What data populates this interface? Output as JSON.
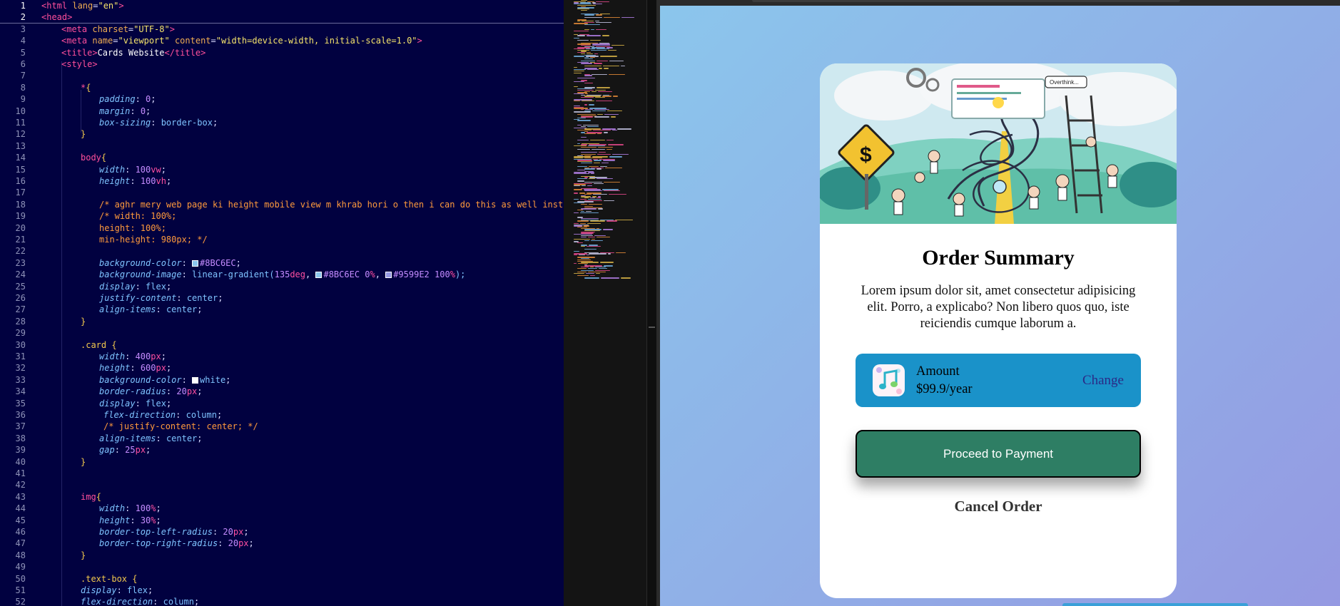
{
  "editor": {
    "line_numbers": [
      "1",
      "2",
      "3",
      "4",
      "5",
      "6",
      "7",
      "8",
      "9",
      "10",
      "11",
      "12",
      "13",
      "14",
      "15",
      "16",
      "17",
      "18",
      "19",
      "20",
      "21",
      "22",
      "23",
      "24",
      "25",
      "26",
      "27",
      "28",
      "29",
      "30",
      "31",
      "32",
      "33",
      "34",
      "35",
      "36",
      "37",
      "38",
      "39",
      "40",
      "41",
      "42",
      "43",
      "44",
      "45",
      "46",
      "47",
      "48",
      "49",
      "50",
      "51",
      "52"
    ],
    "lines": {
      "l1_tag": "<html",
      "l1_attr": " lang",
      "l1_eq": "=",
      "l1_val": "\"en\"",
      "l1_close": ">",
      "l2": "<head>",
      "l3_tag": "<meta",
      "l3_attr": " charset",
      "l3_eq": "=",
      "l3_val": "\"UTF-8\"",
      "l3_close": ">",
      "l4_tag": "<meta",
      "l4_attr1": " name",
      "l4_eq1": "=",
      "l4_val1": "\"viewport\"",
      "l4_attr2": " content",
      "l4_eq2": "=",
      "l4_val2": "\"width=device-width, initial-scale=1.0\"",
      "l4_close": ">",
      "l5_open": "<title>",
      "l5_text": "Cards Website",
      "l5_close": "</title>",
      "l6": "<style>",
      "l8_sel": "*",
      "l8_brace": "{",
      "l9_prop": "padding",
      "l9_sep": ": ",
      "l9_val": "0",
      "l9_end": ";",
      "l10_prop": "margin",
      "l10_sep": ": ",
      "l10_val": "0",
      "l10_end": ";",
      "l11_prop": "box-sizing",
      "l11_sep": ": ",
      "l11_val": "border-box",
      "l11_end": ";",
      "l12": "}",
      "l14_sel": "body",
      "l14_brace": "{",
      "l15_prop": "width",
      "l15_sep": ": ",
      "l15_num": "100",
      "l15_unit": "vw",
      "l15_end": ";",
      "l16_prop": "height",
      "l16_sep": ": ",
      "l16_num": "100",
      "l16_unit": "vh",
      "l16_end": ";",
      "l18": "/* aghr mery web page ki height mobile view m khrab hori o then i can do this as well instead of above",
      "l19": "/* width: 100%;",
      "l20": "height: 100%;",
      "l21": "min-height: 980px; */",
      "l23_prop": "background-color",
      "l23_sep": ": ",
      "l23_val": "#8BC6EC",
      "l23_end": ";",
      "l24_prop": "background-image",
      "l24_sep": ": ",
      "l24_fn": "linear-gradient(",
      "l24_deg": "135",
      "l24_degu": "deg",
      "l24_c1": "#8BC6EC",
      "l24_p1": "0",
      "l24_p1u": "%",
      "l24_c2": "#9599E2",
      "l24_p2": "100",
      "l24_p2u": "%",
      "l24_end": ");",
      "l25_prop": "display",
      "l25_sep": ": ",
      "l25_val": "flex",
      "l25_end": ";",
      "l26_prop": "justify-content",
      "l26_sep": ": ",
      "l26_val": "center",
      "l26_end": ";",
      "l27_prop": "align-items",
      "l27_sep": ": ",
      "l27_val": "center",
      "l27_end": ";",
      "l28": "}",
      "l30_sel": ".card",
      "l30_brace": " {",
      "l31_prop": "width",
      "l31_sep": ": ",
      "l31_num": "400",
      "l31_unit": "px",
      "l31_end": ";",
      "l32_prop": "height",
      "l32_sep": ": ",
      "l32_num": "600",
      "l32_unit": "px",
      "l32_end": ";",
      "l33_prop": "background-color",
      "l33_sep": ": ",
      "l33_val": "white",
      "l33_end": ";",
      "l34_prop": "border-radius",
      "l34_sep": ": ",
      "l34_num": "20",
      "l34_unit": "px",
      "l34_end": ";",
      "l35_prop": "display",
      "l35_sep": ": ",
      "l35_val": "flex",
      "l35_end": ";",
      "l36_prop": "flex-direction",
      "l36_sep": ": ",
      "l36_val": "column",
      "l36_end": ";",
      "l37": "/* justify-content: center; */",
      "l38_prop": "align-items",
      "l38_sep": ": ",
      "l38_val": "center",
      "l38_end": ";",
      "l39_prop": "gap",
      "l39_sep": ": ",
      "l39_num": "25",
      "l39_unit": "px",
      "l39_end": ";",
      "l40": "}",
      "l43_sel": "img",
      "l43_brace": "{",
      "l44_prop": "width",
      "l44_sep": ": ",
      "l44_num": "100",
      "l44_unit": "%",
      "l44_end": ";",
      "l45_prop": "height",
      "l45_sep": ": ",
      "l45_num": "30",
      "l45_unit": "%",
      "l45_end": ";",
      "l46_prop": "border-top-left-radius",
      "l46_sep": ": ",
      "l46_num": "20",
      "l46_unit": "px",
      "l46_end": ";",
      "l47_prop": "border-top-right-radius",
      "l47_sep": ": ",
      "l47_num": "20",
      "l47_unit": "px",
      "l47_end": ";",
      "l48": "}",
      "l50_sel": ".text-box",
      "l50_brace": " {",
      "l51_prop": "display",
      "l51_sep": ": ",
      "l51_val": "flex",
      "l51_end": ";",
      "l52_prop": "flex-direction",
      "l52_sep": ": ",
      "l52_val": "column",
      "l52_end": ";"
    }
  },
  "preview": {
    "card": {
      "hero_image": "illustration-hero",
      "title": "Order Summary",
      "description": "Lorem ipsum dolor sit, amet consectetur adipisicing elit. Porro, a explicabo? Non libero quos quo, iste reiciendis cumque laborum a.",
      "plan": {
        "icon": "music-note-icon",
        "label": "Amount",
        "price": "$99.9/year",
        "change_label": "Change"
      },
      "pay_button_label": "Proceed to Payment",
      "cancel_label": "Cancel Order"
    },
    "hero_sign_text": "Overthink...",
    "hero_dollar_sign": "$"
  },
  "colors": {
    "editor_bg": "#010140",
    "gradient_start": "#8BC6EC",
    "gradient_end": "#9599E2",
    "amount_box": "#1a92c9",
    "pay_button": "#2e7e64",
    "change_link": "#2b2a86"
  }
}
